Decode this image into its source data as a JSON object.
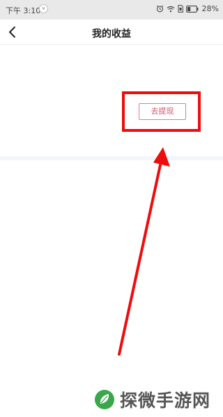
{
  "status_bar": {
    "time": "下午 3:10",
    "notification_badge": "v",
    "battery": "28%"
  },
  "nav": {
    "title": "我的收益",
    "back_icon": "chevron-left-icon"
  },
  "content": {
    "withdraw_label": "去提现"
  },
  "annotation": {
    "color": "#ee0c0c"
  },
  "watermark": {
    "text": "探微手游网",
    "logo_color": "#3aa84a"
  }
}
